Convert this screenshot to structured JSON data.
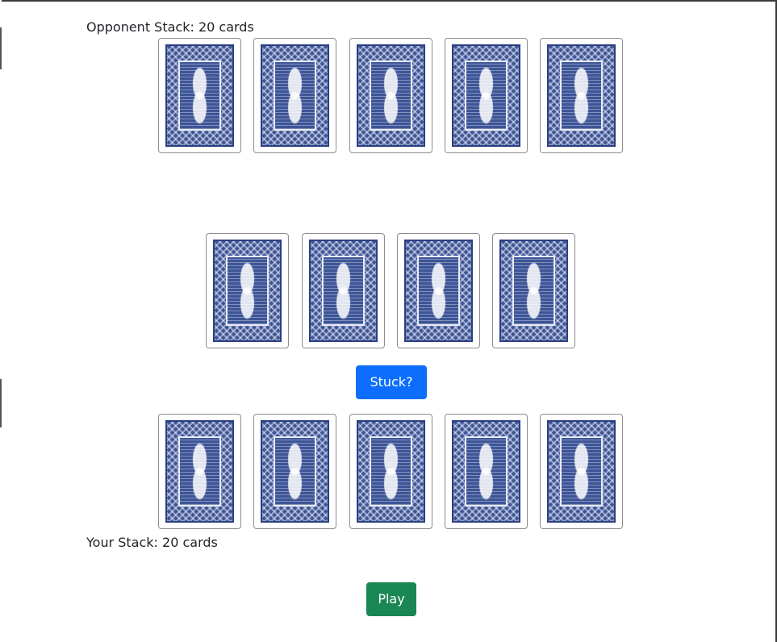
{
  "opponent": {
    "stack_label": "Opponent Stack: 20 cards",
    "hand": [
      {
        "face": "back"
      },
      {
        "face": "back"
      },
      {
        "face": "back"
      },
      {
        "face": "back"
      },
      {
        "face": "back"
      }
    ]
  },
  "table": {
    "piles": [
      {
        "face": "back"
      },
      {
        "face": "back"
      },
      {
        "face": "back"
      },
      {
        "face": "back"
      }
    ]
  },
  "player": {
    "stack_label": "Your Stack: 20 cards",
    "hand": [
      {
        "face": "back"
      },
      {
        "face": "back"
      },
      {
        "face": "back"
      },
      {
        "face": "back"
      },
      {
        "face": "back"
      }
    ]
  },
  "buttons": {
    "stuck_label": "Stuck?",
    "play_label": "Play"
  },
  "colors": {
    "card_back": "#3d5497",
    "stuck_button": "#0d6efd",
    "play_button": "#198754"
  }
}
